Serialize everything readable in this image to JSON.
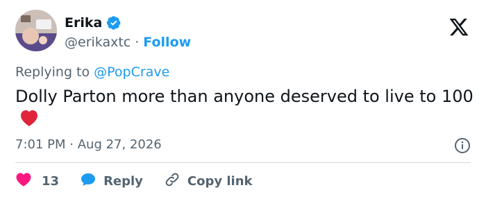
{
  "author": {
    "display_name": "Erika",
    "handle": "@erikaxtc",
    "separator": "·",
    "follow_label": "Follow"
  },
  "reply_context": {
    "prefix": "Replying to ",
    "mention": "@PopCrave"
  },
  "tweet": {
    "text": "Dolly Parton more than anyone deserved to live to 100",
    "emoji": "red-heart"
  },
  "meta": {
    "time": "7:01 PM",
    "separator": "·",
    "date": "Aug 27, 2026"
  },
  "actions": {
    "like_count": "13",
    "reply_label": "Reply",
    "copy_label": "Copy link"
  },
  "colors": {
    "accent": "#1d9bf0",
    "like": "#f91880",
    "text": "#0f1419",
    "muted": "#536471",
    "divider": "#cfd9de"
  },
  "icons": [
    "verified-badge-icon",
    "x-logo-icon",
    "info-icon",
    "heart-icon",
    "reply-bubble-icon",
    "link-icon"
  ]
}
